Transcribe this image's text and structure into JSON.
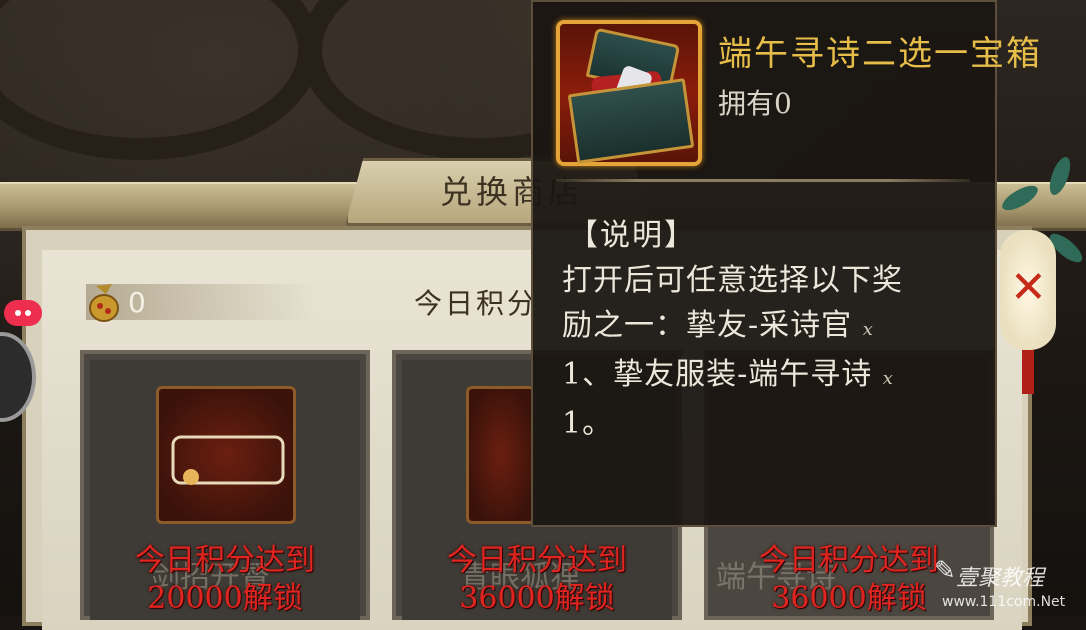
{
  "shop": {
    "title": "兑换商店",
    "points_value": "0",
    "today_label": "今日积分",
    "cards": [
      {
        "name": "剑招开督",
        "unlock_line1": "今日积分达到",
        "unlock_line2": "20000解锁"
      },
      {
        "name": "青眼狐狸",
        "unlock_line1": "今日积分达到",
        "unlock_line2": "36000解锁"
      },
      {
        "name": "端午寻诗",
        "unlock_line1": "今日积分达到",
        "unlock_line2": "36000解锁"
      }
    ]
  },
  "tooltip": {
    "item_name": "端午寻诗二选一宝箱",
    "owned": "拥有0",
    "header": "【说明】",
    "desc_line1": "打开后可任意选择以下奖",
    "desc_line2": "励之一：挚友-采诗官",
    "desc_line3": "1、挚友服装-端午寻诗",
    "desc_line4": "1。",
    "multiplier": "x"
  },
  "watermark": {
    "name": "壹聚教程",
    "url": "www.111com.Net"
  },
  "colors": {
    "unlock_red": "#e0241f",
    "item_name_gold": "#e6bd48",
    "panel_bg": "#d8d1bc"
  },
  "icons": [
    "coin-pouch-icon",
    "treasure-chest-icon",
    "lantern-icon",
    "more-options-icon"
  ]
}
